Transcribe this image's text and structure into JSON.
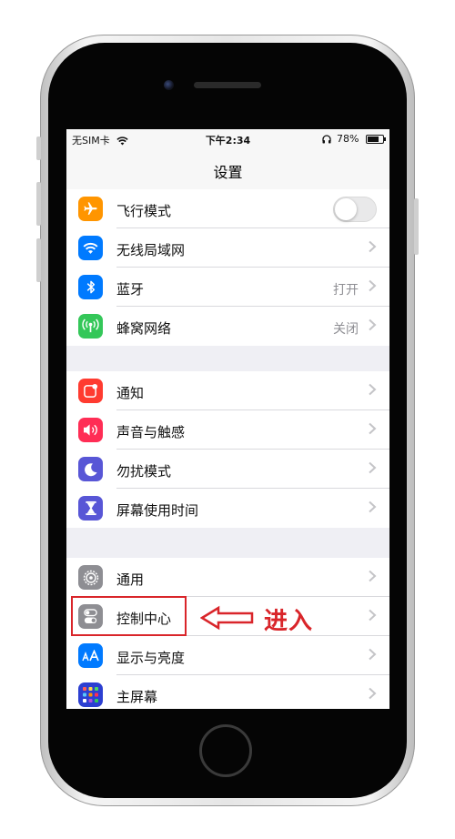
{
  "status_bar": {
    "carrier": "无SIM卡",
    "time": "下午2:34",
    "battery_percent": "78%",
    "battery_level": 0.78
  },
  "nav": {
    "title": "设置"
  },
  "groups": [
    {
      "rows": [
        {
          "label": "飞行模式",
          "icon": "airplane-icon",
          "icon_color": "#ff9500",
          "accessory": "toggle",
          "toggle_on": false
        },
        {
          "label": "无线局域网",
          "icon": "wifi-icon",
          "icon_color": "#007aff",
          "accessory": "chevron"
        },
        {
          "label": "蓝牙",
          "icon": "bluetooth-icon",
          "icon_color": "#007aff",
          "value": "打开",
          "accessory": "chevron"
        },
        {
          "label": "蜂窝网络",
          "icon": "antenna-icon",
          "icon_color": "#34c759",
          "value": "关闭",
          "accessory": "chevron"
        }
      ]
    },
    {
      "rows": [
        {
          "label": "通知",
          "icon": "notification-icon",
          "icon_color": "#ff3b30",
          "accessory": "chevron"
        },
        {
          "label": "声音与触感",
          "icon": "speaker-icon",
          "icon_color": "#ff2d55",
          "accessory": "chevron"
        },
        {
          "label": "勿扰模式",
          "icon": "moon-icon",
          "icon_color": "#5856d6",
          "accessory": "chevron"
        },
        {
          "label": "屏幕使用时间",
          "icon": "hourglass-icon",
          "icon_color": "#5856d6",
          "accessory": "chevron"
        }
      ]
    },
    {
      "rows": [
        {
          "label": "通用",
          "icon": "gear-icon",
          "icon_color": "#8e8e93",
          "accessory": "chevron"
        },
        {
          "label": "控制中心",
          "icon": "switches-icon",
          "icon_color": "#8e8e93",
          "accessory": "chevron"
        },
        {
          "label": "显示与亮度",
          "icon": "text-size-icon",
          "icon_color": "#007aff",
          "accessory": "chevron"
        },
        {
          "label": "主屏幕",
          "icon": "app-grid-icon",
          "icon_color": "#2c3fd1",
          "accessory": "chevron"
        }
      ]
    }
  ],
  "annotation": {
    "text": "进入",
    "color": "#d9252a"
  }
}
